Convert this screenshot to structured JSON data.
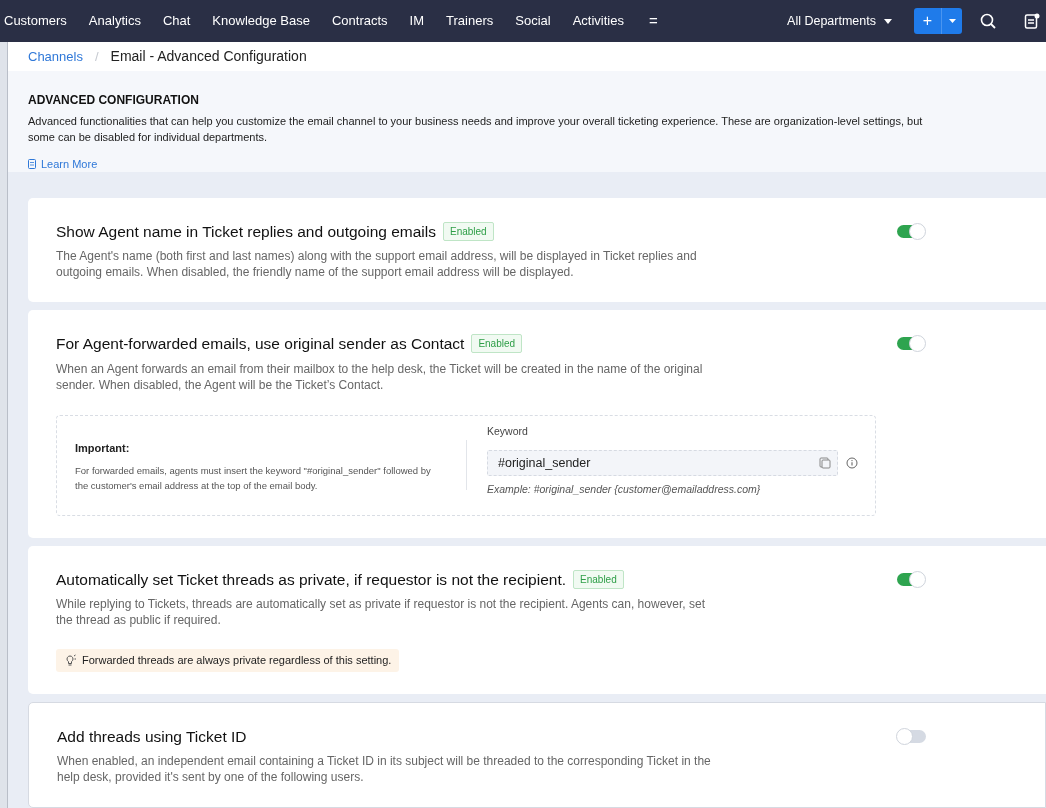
{
  "nav": {
    "items": [
      "Customers",
      "Analytics",
      "Chat",
      "Knowledge Base",
      "Contracts",
      "IM",
      "Trainers",
      "Social",
      "Activities"
    ],
    "more": "=",
    "department": "All Departments",
    "add": "+"
  },
  "breadcrumb": {
    "parent": "Channels",
    "separator": "/",
    "current": "Email - Advanced Configuration"
  },
  "header": {
    "title": "ADVANCED CONFIGURATION",
    "description": "Advanced functionalities that can help you customize the email channel to your business needs and improve your overall ticketing experience. These are organization-level settings, but some can be disabled for individual departments.",
    "link": "Learn More"
  },
  "settings": [
    {
      "kind": "plain",
      "title": "Show Agent name in Ticket replies and outgoing emails",
      "badge": "Enabled",
      "on": true,
      "description": "The Agent's name (both first and last names) along with the support email address, will be displayed in Ticket replies and outgoing emails. When disabled, the friendly name of the support email address will be displayed."
    },
    {
      "kind": "keyword",
      "title": "For Agent-forwarded emails, use original sender as Contact",
      "badge": "Enabled",
      "on": true,
      "description": "When an Agent forwards an email from their mailbox to the help desk, the Ticket will be created in the name of the original sender. When disabled, the Agent will be the Ticket’s Contact.",
      "important_title": "Important:",
      "important_text": "For forwarded emails, agents must insert the keyword \"#original_sender\" followed by the customer's email address at the top of the email body.",
      "keyword_label": "Keyword",
      "keyword_value": "#original_sender",
      "keyword_example": "Example: #original_sender {customer@emailaddress.com}"
    },
    {
      "kind": "note",
      "title": "Automatically set Ticket threads as private, if requestor is not the recipient.",
      "badge": "Enabled",
      "on": true,
      "description": "While replying to Tickets, threads are automatically set as private if requestor is not the recipient. Agents can, however, set the thread as public if required.",
      "note": "Forwarded threads are always private regardless of this setting."
    },
    {
      "kind": "plain",
      "title": "Add threads using Ticket ID",
      "on": false,
      "description": "When enabled, an independent email containing a Ticket ID in its subject will be threaded to the corresponding Ticket in the help desk, provided it's sent by one of the following users."
    }
  ]
}
